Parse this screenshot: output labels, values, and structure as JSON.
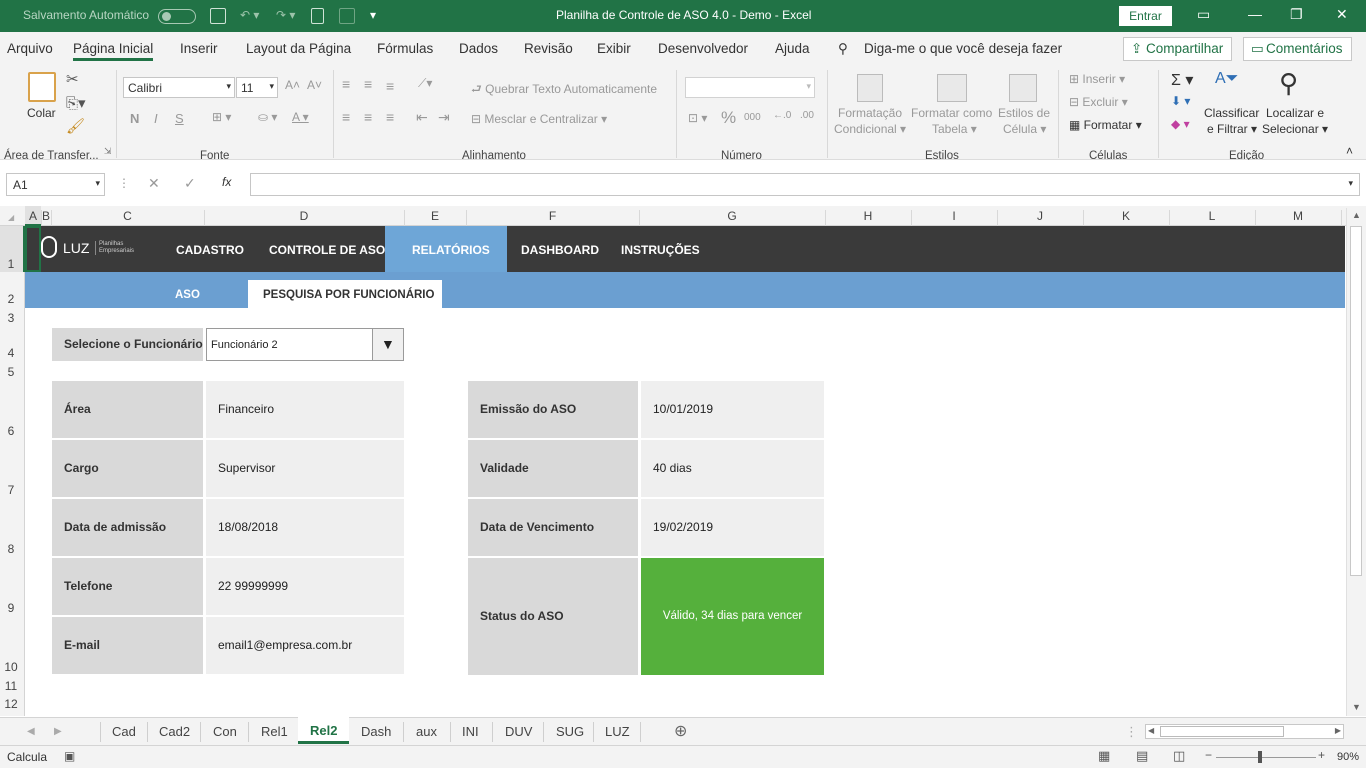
{
  "titlebar": {
    "autosave": "Salvamento Automático",
    "title": "Planilha de Controle de ASO 4.0 - Demo  -  Excel",
    "signin": "Entrar",
    "color": "#217346"
  },
  "menu": {
    "items": [
      "Arquivo",
      "Página Inicial",
      "Inserir",
      "Layout da Página",
      "Fórmulas",
      "Dados",
      "Revisão",
      "Exibir",
      "Desenvolvedor",
      "Ajuda"
    ],
    "search": "Diga-me o que você deseja fazer",
    "share": "Compartilhar",
    "comments": "Comentários"
  },
  "ribbon": {
    "paste": "Colar",
    "clipboard": "Área de Transfer...",
    "font_name": "Calibri",
    "font_size": "11",
    "font_group": "Fonte",
    "bold": "N",
    "italic": "I",
    "underline": "S",
    "wrap": "Quebrar Texto Automaticamente",
    "merge": "Mesclar e Centralizar",
    "align_group": "Alinhamento",
    "number_group": "Número",
    "percent": "%",
    "thousands": "000",
    "cond_format": "Formatação",
    "cond_format2": "Condicional",
    "format_table": "Formatar como",
    "format_table2": "Tabela",
    "cell_styles": "Estilos de",
    "cell_styles2": "Célula",
    "styles_group": "Estilos",
    "insert": "Inserir",
    "delete": "Excluir",
    "format": "Formatar",
    "cells_group": "Células",
    "sort": "Classificar",
    "sort2": "e Filtrar",
    "find": "Localizar e",
    "find2": "Selecionar",
    "edit_group": "Edição"
  },
  "formula_bar": {
    "name_box": "A1",
    "fx": "fx",
    "value": ""
  },
  "columns": [
    "A",
    "B",
    "C",
    "D",
    "E",
    "F",
    "G",
    "H",
    "I",
    "J",
    "K",
    "L",
    "M"
  ],
  "rows": [
    "1",
    "2",
    "3",
    "4",
    "5",
    "6",
    "7",
    "8",
    "9",
    "10",
    "11",
    "12"
  ],
  "sheet": {
    "logo": "LUZ",
    "logo_sub1": "Planilhas",
    "logo_sub2": "Empresariais",
    "nav": [
      "CADASTRO",
      "CONTROLE DE ASO",
      "RELATÓRIOS",
      "DASHBOARD",
      "INSTRUÇÕES"
    ],
    "subnav": [
      "ASO",
      "PESQUISA POR FUNCIONÁRIO"
    ],
    "select_label": "Selecione o Funcionário",
    "select_value": "Funcionário 2",
    "left": [
      {
        "label": "Área",
        "value": "Financeiro"
      },
      {
        "label": "Cargo",
        "value": "Supervisor"
      },
      {
        "label": "Data de admissão",
        "value": "18/08/2018"
      },
      {
        "label": "Telefone",
        "value": "22 99999999"
      },
      {
        "label": "E-mail",
        "value": "email1@empresa.com.br"
      }
    ],
    "right": [
      {
        "label": "Emissão do ASO",
        "value": "10/01/2019"
      },
      {
        "label": "Validade",
        "value": "40 dias"
      },
      {
        "label": "Data de Vencimento",
        "value": "19/02/2019"
      }
    ],
    "status_label": "Status do ASO",
    "status_value": "Válido, 34 dias para vencer",
    "status_color": "#55b03c"
  },
  "tabs": [
    "Cad",
    "Cad2",
    "Con",
    "Rel1",
    "Rel2",
    "Dash",
    "aux",
    "INI",
    "DUV",
    "SUG",
    "LUZ"
  ],
  "active_tab": "Rel2",
  "status": {
    "mode": "Calcula",
    "zoom": "90%"
  }
}
